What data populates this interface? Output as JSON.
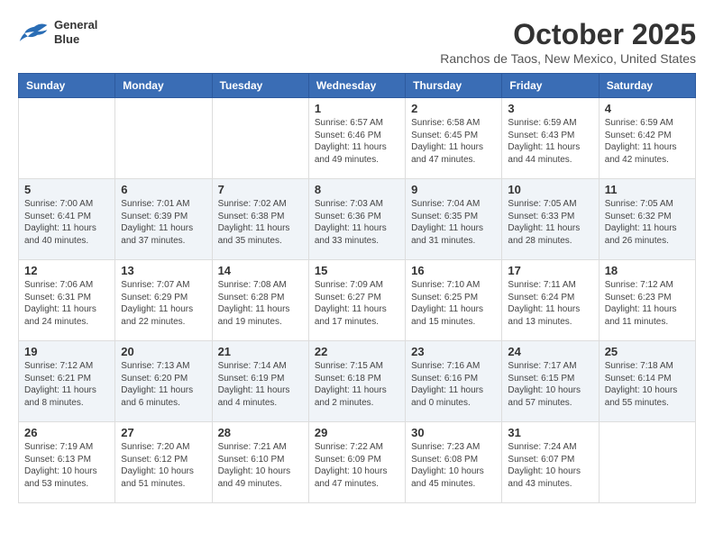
{
  "header": {
    "logo_line1": "General",
    "logo_line2": "Blue",
    "month_title": "October 2025",
    "location": "Ranchos de Taos, New Mexico, United States"
  },
  "weekdays": [
    "Sunday",
    "Monday",
    "Tuesday",
    "Wednesday",
    "Thursday",
    "Friday",
    "Saturday"
  ],
  "weeks": [
    [
      {
        "day": "",
        "info": ""
      },
      {
        "day": "",
        "info": ""
      },
      {
        "day": "",
        "info": ""
      },
      {
        "day": "1",
        "info": "Sunrise: 6:57 AM\nSunset: 6:46 PM\nDaylight: 11 hours\nand 49 minutes."
      },
      {
        "day": "2",
        "info": "Sunrise: 6:58 AM\nSunset: 6:45 PM\nDaylight: 11 hours\nand 47 minutes."
      },
      {
        "day": "3",
        "info": "Sunrise: 6:59 AM\nSunset: 6:43 PM\nDaylight: 11 hours\nand 44 minutes."
      },
      {
        "day": "4",
        "info": "Sunrise: 6:59 AM\nSunset: 6:42 PM\nDaylight: 11 hours\nand 42 minutes."
      }
    ],
    [
      {
        "day": "5",
        "info": "Sunrise: 7:00 AM\nSunset: 6:41 PM\nDaylight: 11 hours\nand 40 minutes."
      },
      {
        "day": "6",
        "info": "Sunrise: 7:01 AM\nSunset: 6:39 PM\nDaylight: 11 hours\nand 37 minutes."
      },
      {
        "day": "7",
        "info": "Sunrise: 7:02 AM\nSunset: 6:38 PM\nDaylight: 11 hours\nand 35 minutes."
      },
      {
        "day": "8",
        "info": "Sunrise: 7:03 AM\nSunset: 6:36 PM\nDaylight: 11 hours\nand 33 minutes."
      },
      {
        "day": "9",
        "info": "Sunrise: 7:04 AM\nSunset: 6:35 PM\nDaylight: 11 hours\nand 31 minutes."
      },
      {
        "day": "10",
        "info": "Sunrise: 7:05 AM\nSunset: 6:33 PM\nDaylight: 11 hours\nand 28 minutes."
      },
      {
        "day": "11",
        "info": "Sunrise: 7:05 AM\nSunset: 6:32 PM\nDaylight: 11 hours\nand 26 minutes."
      }
    ],
    [
      {
        "day": "12",
        "info": "Sunrise: 7:06 AM\nSunset: 6:31 PM\nDaylight: 11 hours\nand 24 minutes."
      },
      {
        "day": "13",
        "info": "Sunrise: 7:07 AM\nSunset: 6:29 PM\nDaylight: 11 hours\nand 22 minutes."
      },
      {
        "day": "14",
        "info": "Sunrise: 7:08 AM\nSunset: 6:28 PM\nDaylight: 11 hours\nand 19 minutes."
      },
      {
        "day": "15",
        "info": "Sunrise: 7:09 AM\nSunset: 6:27 PM\nDaylight: 11 hours\nand 17 minutes."
      },
      {
        "day": "16",
        "info": "Sunrise: 7:10 AM\nSunset: 6:25 PM\nDaylight: 11 hours\nand 15 minutes."
      },
      {
        "day": "17",
        "info": "Sunrise: 7:11 AM\nSunset: 6:24 PM\nDaylight: 11 hours\nand 13 minutes."
      },
      {
        "day": "18",
        "info": "Sunrise: 7:12 AM\nSunset: 6:23 PM\nDaylight: 11 hours\nand 11 minutes."
      }
    ],
    [
      {
        "day": "19",
        "info": "Sunrise: 7:12 AM\nSunset: 6:21 PM\nDaylight: 11 hours\nand 8 minutes."
      },
      {
        "day": "20",
        "info": "Sunrise: 7:13 AM\nSunset: 6:20 PM\nDaylight: 11 hours\nand 6 minutes."
      },
      {
        "day": "21",
        "info": "Sunrise: 7:14 AM\nSunset: 6:19 PM\nDaylight: 11 hours\nand 4 minutes."
      },
      {
        "day": "22",
        "info": "Sunrise: 7:15 AM\nSunset: 6:18 PM\nDaylight: 11 hours\nand 2 minutes."
      },
      {
        "day": "23",
        "info": "Sunrise: 7:16 AM\nSunset: 6:16 PM\nDaylight: 11 hours\nand 0 minutes."
      },
      {
        "day": "24",
        "info": "Sunrise: 7:17 AM\nSunset: 6:15 PM\nDaylight: 10 hours\nand 57 minutes."
      },
      {
        "day": "25",
        "info": "Sunrise: 7:18 AM\nSunset: 6:14 PM\nDaylight: 10 hours\nand 55 minutes."
      }
    ],
    [
      {
        "day": "26",
        "info": "Sunrise: 7:19 AM\nSunset: 6:13 PM\nDaylight: 10 hours\nand 53 minutes."
      },
      {
        "day": "27",
        "info": "Sunrise: 7:20 AM\nSunset: 6:12 PM\nDaylight: 10 hours\nand 51 minutes."
      },
      {
        "day": "28",
        "info": "Sunrise: 7:21 AM\nSunset: 6:10 PM\nDaylight: 10 hours\nand 49 minutes."
      },
      {
        "day": "29",
        "info": "Sunrise: 7:22 AM\nSunset: 6:09 PM\nDaylight: 10 hours\nand 47 minutes."
      },
      {
        "day": "30",
        "info": "Sunrise: 7:23 AM\nSunset: 6:08 PM\nDaylight: 10 hours\nand 45 minutes."
      },
      {
        "day": "31",
        "info": "Sunrise: 7:24 AM\nSunset: 6:07 PM\nDaylight: 10 hours\nand 43 minutes."
      },
      {
        "day": "",
        "info": ""
      }
    ]
  ]
}
